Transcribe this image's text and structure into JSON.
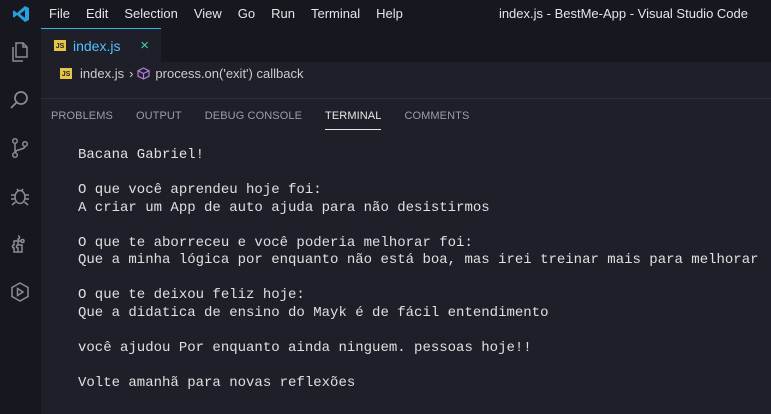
{
  "menu": [
    "File",
    "Edit",
    "Selection",
    "View",
    "Go",
    "Run",
    "Terminal",
    "Help"
  ],
  "window_title": "index.js - BestMe-App - Visual Studio Code",
  "activity_icons": [
    "explorer-icon",
    "search-icon",
    "source-control-icon",
    "run-debug-icon",
    "extensions-icon",
    "remote-explorer-icon"
  ],
  "editor": {
    "tab": {
      "badge": "JS",
      "label": "index.js",
      "close": "×"
    },
    "breadcrumb": {
      "file": "index.js",
      "separator": "›",
      "symbol": "process.on('exit') callback"
    }
  },
  "panel": {
    "tabs": [
      "PROBLEMS",
      "OUTPUT",
      "DEBUG CONSOLE",
      "TERMINAL",
      "COMMENTS"
    ],
    "active_tab": "TERMINAL"
  },
  "terminal": {
    "lines": [
      "Bacana Gabriel!",
      "",
      "O que você aprendeu hoje foi:",
      "A criar um App de auto ajuda para não desistirmos",
      "",
      "O que te aborreceu e você poderia melhorar foi:",
      "Que a minha lógica por enquanto não está boa, mas irei treinar mais para melhorar",
      "",
      "O que te deixou feliz hoje:",
      "Que a didatica de ensino do Mayk é de fácil entendimento",
      "",
      "você ajudou Por enquanto ainda ninguem. pessoas hoje!!",
      "",
      "Volte amanhã para novas reflexões"
    ]
  },
  "colors": {
    "accent": "#37b3e0",
    "tab_label": "#4fc1ff",
    "close": "#3fd6a0",
    "js_badge": "#e7c547"
  }
}
